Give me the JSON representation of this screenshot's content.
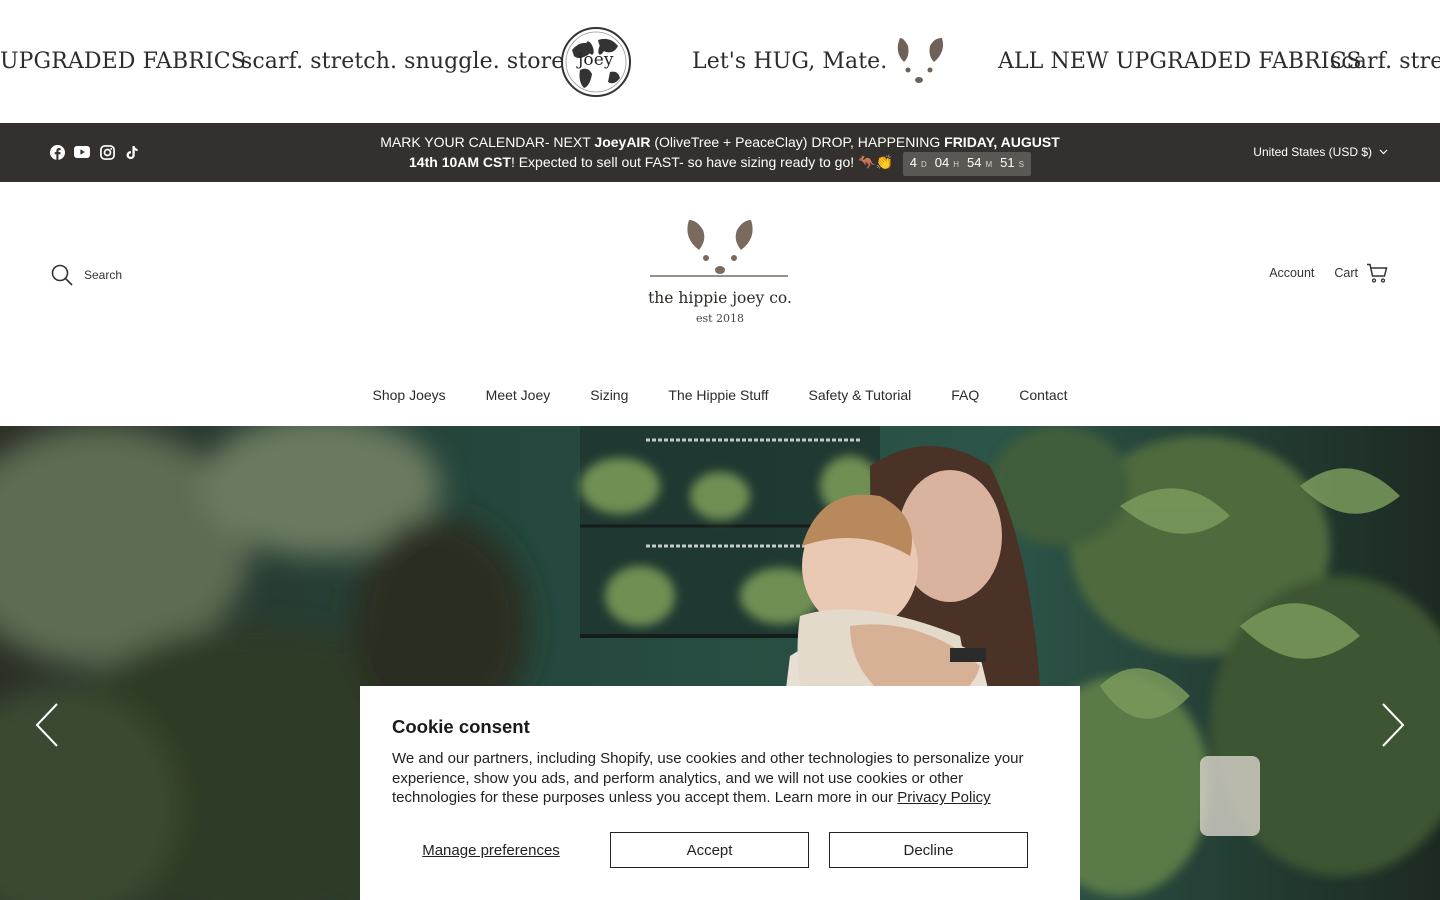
{
  "marquee": {
    "items": [
      "UPGRADED FABRICS",
      "scarf. stretch. snuggle. store.",
      "Let's HUG, Mate.",
      "ALL NEW UPGRADED FABRICS",
      "scarf. stretch"
    ],
    "globe_logo_text": "joey"
  },
  "announcement": {
    "social_icons": [
      "facebook-icon",
      "youtube-icon",
      "instagram-icon",
      "tiktok-icon"
    ],
    "text_part1": "MARK YOUR CALENDAR- NEXT ",
    "text_bold1": "JoeyAIR",
    "text_part2": " (OliveTree + PeaceClay) DROP, HAPPENING ",
    "text_bold2": "FRIDAY, AUGUST 14th 10AM CST",
    "text_part3": "! Expected to sell out FAST- so have sizing ready to go! 🦘👏",
    "countdown": {
      "days": "4",
      "days_unit": "D",
      "hours": "04",
      "hours_unit": "H",
      "minutes": "54",
      "minutes_unit": "M",
      "seconds": "51",
      "seconds_unit": "S"
    },
    "locale": "United States (USD $)"
  },
  "header": {
    "search_label": "Search",
    "brand": "the hippie joey co.",
    "est": "est 2018",
    "account_label": "Account",
    "cart_label": "Cart"
  },
  "nav": {
    "items": [
      "Shop Joeys",
      "Meet Joey",
      "Sizing",
      "The Hippie Stuff",
      "Safety & Tutorial",
      "FAQ",
      "Contact"
    ]
  },
  "cookie": {
    "title": "Cookie consent",
    "body": "We and our partners, including Shopify, use cookies and other technologies to personalize your experience, show you ads, and perform analytics, and we will not use cookies or other technologies for these purposes unless you accept them. Learn more in our ",
    "policy_link": "Privacy Policy",
    "manage_label": "Manage preferences",
    "accept_label": "Accept",
    "decline_label": "Decline"
  },
  "colors": {
    "announcement_bg": "#34302d",
    "brand_brown": "#7a6a5e",
    "hero_green": "#1f3a32"
  }
}
